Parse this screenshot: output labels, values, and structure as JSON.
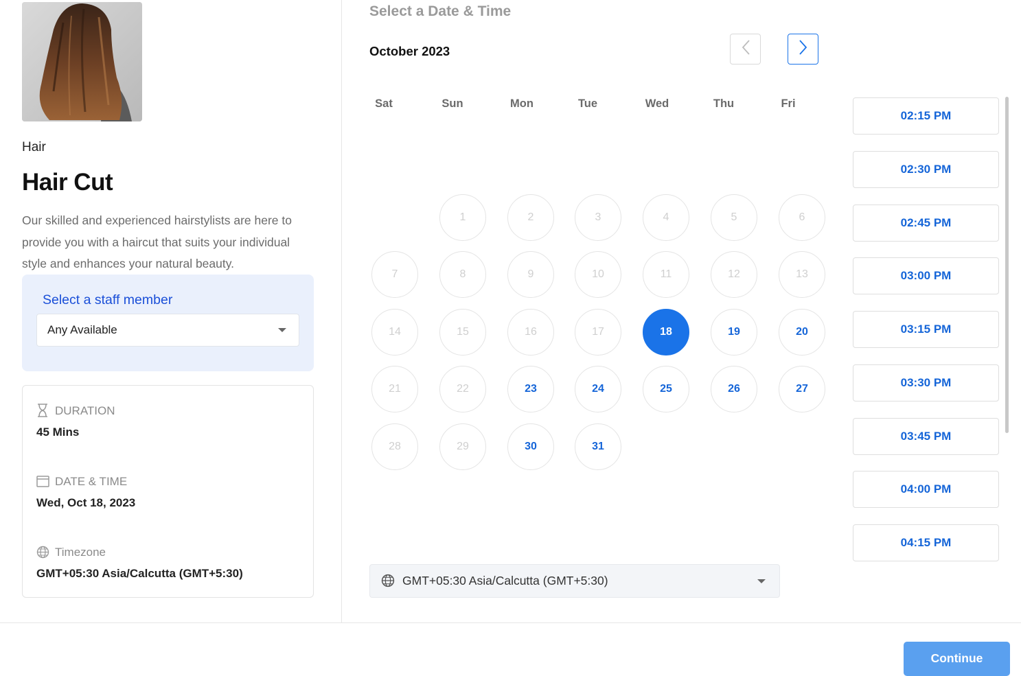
{
  "service": {
    "category": "Hair",
    "title": "Hair Cut",
    "description": "Our skilled and experienced hairstylists are here to provide you with a haircut that suits your individual style and enhances your natural beauty."
  },
  "staff": {
    "label": "Select a staff member",
    "selected": "Any Available"
  },
  "summary": {
    "duration_label": "DURATION",
    "duration_value": "45 Mins",
    "datetime_label": "DATE & TIME",
    "datetime_value": "Wed, Oct 18, 2023",
    "timezone_label": "Timezone",
    "timezone_value": "GMT+05:30 Asia/Calcutta (GMT+5:30)"
  },
  "calendar": {
    "heading": "Select a Date & Time",
    "month": "October 2023",
    "weekdays": [
      "Sat",
      "Sun",
      "Mon",
      "Tue",
      "Wed",
      "Thu",
      "Fri"
    ],
    "days": [
      {
        "n": "1",
        "state": "disabled"
      },
      {
        "n": "2",
        "state": "disabled"
      },
      {
        "n": "3",
        "state": "disabled"
      },
      {
        "n": "4",
        "state": "disabled"
      },
      {
        "n": "5",
        "state": "disabled"
      },
      {
        "n": "6",
        "state": "disabled"
      },
      {
        "n": "7",
        "state": "disabled"
      },
      {
        "n": "8",
        "state": "disabled"
      },
      {
        "n": "9",
        "state": "disabled"
      },
      {
        "n": "10",
        "state": "disabled"
      },
      {
        "n": "11",
        "state": "disabled"
      },
      {
        "n": "12",
        "state": "disabled"
      },
      {
        "n": "13",
        "state": "disabled"
      },
      {
        "n": "14",
        "state": "disabled"
      },
      {
        "n": "15",
        "state": "disabled"
      },
      {
        "n": "16",
        "state": "disabled"
      },
      {
        "n": "17",
        "state": "disabled"
      },
      {
        "n": "18",
        "state": "selected"
      },
      {
        "n": "19",
        "state": "available"
      },
      {
        "n": "20",
        "state": "available"
      },
      {
        "n": "21",
        "state": "disabled"
      },
      {
        "n": "22",
        "state": "disabled"
      },
      {
        "n": "23",
        "state": "available"
      },
      {
        "n": "24",
        "state": "available"
      },
      {
        "n": "25",
        "state": "available"
      },
      {
        "n": "26",
        "state": "available"
      },
      {
        "n": "27",
        "state": "available"
      },
      {
        "n": "28",
        "state": "disabled"
      },
      {
        "n": "29",
        "state": "disabled"
      },
      {
        "n": "30",
        "state": "available"
      },
      {
        "n": "31",
        "state": "available"
      }
    ]
  },
  "time_slots": [
    "02:15 PM",
    "02:30 PM",
    "02:45 PM",
    "03:00 PM",
    "03:15 PM",
    "03:30 PM",
    "03:45 PM",
    "04:00 PM",
    "04:15 PM"
  ],
  "timezone_select": {
    "value": "GMT+05:30 Asia/Calcutta (GMT+5:30)"
  },
  "actions": {
    "continue_label": "Continue"
  },
  "colors": {
    "accent": "#1a73e8",
    "available_text": "#1565d8",
    "staff_label": "#1a4fd8",
    "continue_bg": "#5aa0ef"
  },
  "icons": {
    "duration": "hourglass-icon",
    "datetime": "calendar-icon",
    "timezone": "globe-icon",
    "prev": "chevron-left-icon",
    "next": "chevron-right-icon",
    "dropdown": "caret-down-icon"
  }
}
